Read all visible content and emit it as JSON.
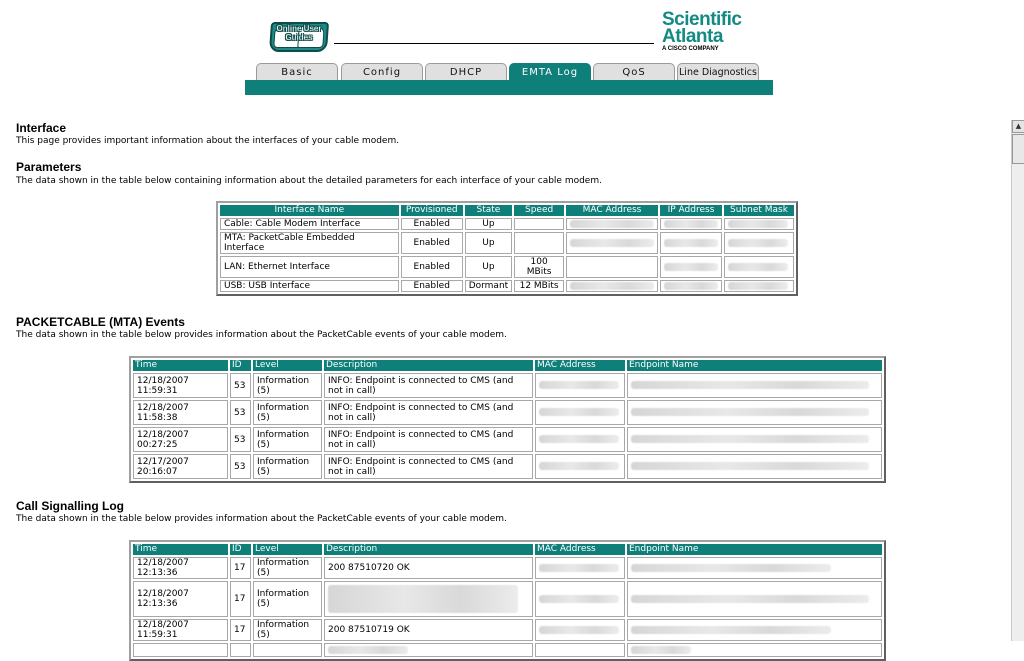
{
  "header": {
    "logo_text": "Online User Guides",
    "brand_line1": "Scientific",
    "brand_line2": "Atlanta",
    "brand_line3": "A CISCO COMPANY",
    "tabs": [
      {
        "label": "Basic",
        "active": false
      },
      {
        "label": "Config",
        "active": false
      },
      {
        "label": "DHCP",
        "active": false
      },
      {
        "label": "EMTA Log",
        "active": true
      },
      {
        "label": "QoS",
        "active": false
      },
      {
        "label": "Line Diagnostics",
        "active": false
      }
    ],
    "accent_color": "#0f7f7a",
    "brand_color": "#138a83"
  },
  "interface": {
    "title": "Interface",
    "description": "This page provides important information about the interfaces of your cable modem."
  },
  "parameters": {
    "title": "Parameters",
    "description": "The data shown in the table below containing information about the detailed parameters for each interface of your cable modem.",
    "columns": [
      "Interface Name",
      "Provisioned",
      "State",
      "Speed",
      "MAC Address",
      "IP Address",
      "Subnet Mask"
    ],
    "rows": [
      [
        "Cable: Cable Modem Interface",
        "Enabled",
        "Up",
        "",
        "",
        "",
        ""
      ],
      [
        "MTA: PacketCable Embedded Interface",
        "Enabled",
        "Up",
        "",
        "",
        "",
        ""
      ],
      [
        "LAN: Ethernet Interface",
        "Enabled",
        "Up",
        "100 MBits",
        "",
        "",
        ""
      ],
      [
        "USB: USB Interface",
        "Enabled",
        "Dormant",
        "12 MBits",
        "",
        "",
        ""
      ]
    ]
  },
  "events": {
    "title": "PACKETCABLE (MTA) Events",
    "description": "The data shown in the table below provides information about the PacketCable events of your cable modem.",
    "columns": [
      "Time",
      "ID",
      "Level",
      "Description",
      "MAC Address",
      "Endpoint Name"
    ],
    "rows": [
      [
        "12/18/2007 11:59:31",
        "53",
        "Information (5)",
        "INFO: Endpoint is connected to CMS (and not in call)",
        "",
        ""
      ],
      [
        "12/18/2007 11:58:38",
        "53",
        "Information (5)",
        "INFO: Endpoint is connected to CMS (and not in call)",
        "",
        ""
      ],
      [
        "12/18/2007 00:27:25",
        "53",
        "Information (5)",
        "INFO: Endpoint is connected to CMS (and not in call)",
        "",
        ""
      ],
      [
        "12/17/2007 20:16:07",
        "53",
        "Information (5)",
        "INFO: Endpoint is connected to CMS (and not in call)",
        "",
        ""
      ]
    ]
  },
  "signalling": {
    "title": "Call Signalling Log",
    "description": "The data shown in the table below provides information about the PacketCable events of your cable modem.",
    "columns": [
      "Time",
      "ID",
      "Level",
      "Description",
      "MAC Address",
      "Endpoint Name"
    ],
    "rows": [
      [
        "12/18/2007 12:13:36",
        "17",
        "Information (5)",
        "200 87510720 OK",
        "",
        ""
      ],
      [
        "12/18/2007 12:13:36",
        "17",
        "Information (5)",
        "",
        "",
        ""
      ],
      [
        "12/18/2007 11:59:31",
        "17",
        "Information (5)",
        "200 87510719 OK",
        "",
        ""
      ],
      [
        "",
        "",
        "",
        "",
        "",
        ""
      ]
    ]
  },
  "scrollbar": {
    "up_icon": "triangle-up-icon"
  }
}
